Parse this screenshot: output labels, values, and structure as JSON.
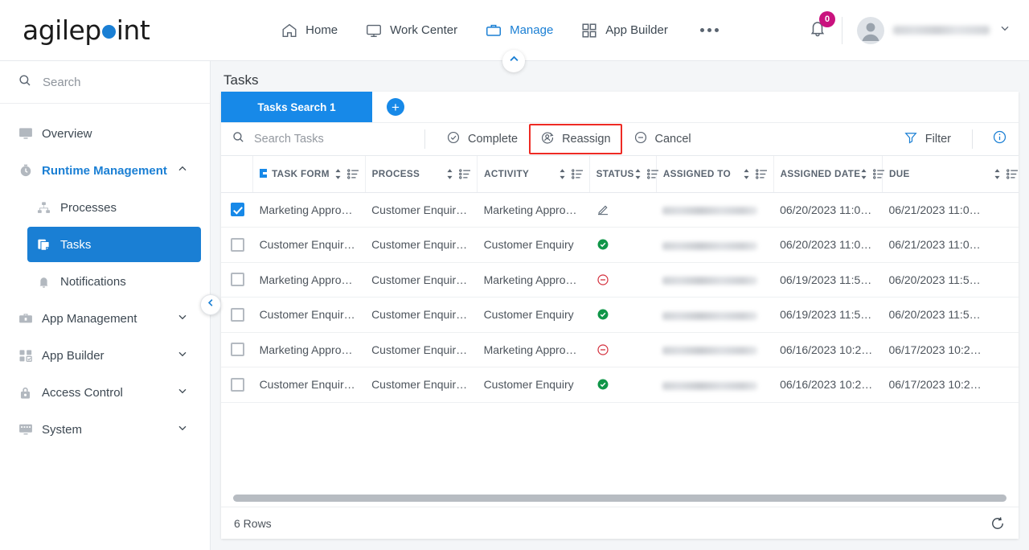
{
  "header": {
    "logo": {
      "prefix": "agilep",
      "suffix": "int",
      "dot_color": "#1a7fd4"
    },
    "nav": [
      {
        "label": "Home",
        "icon": "home-icon",
        "active": false
      },
      {
        "label": "Work Center",
        "icon": "monitor-icon",
        "active": false
      },
      {
        "label": "Manage",
        "icon": "briefcase-icon",
        "active": true
      },
      {
        "label": "App Builder",
        "icon": "grid-icon",
        "active": false
      },
      {
        "label": "",
        "icon": "more-dots-icon",
        "active": false
      }
    ],
    "notification_badge": "0",
    "user_name": "",
    "accent_color": "#1a7fd4",
    "badge_color": "#c9127e"
  },
  "sidebar": {
    "search_placeholder": "Search",
    "items": [
      {
        "label": "Overview",
        "icon": "overview-icon",
        "level": 0,
        "state": "normal",
        "chevron": ""
      },
      {
        "label": "Runtime Management",
        "icon": "clock-icon",
        "level": 0,
        "state": "open",
        "chevron": "up"
      },
      {
        "label": "Processes",
        "icon": "process-icon",
        "level": 1,
        "state": "normal",
        "chevron": ""
      },
      {
        "label": "Tasks",
        "icon": "tasks-icon",
        "level": 1,
        "state": "selected",
        "chevron": ""
      },
      {
        "label": "Notifications",
        "icon": "bell-icon",
        "level": 1,
        "state": "normal",
        "chevron": ""
      },
      {
        "label": "App Management",
        "icon": "toolbox-icon",
        "level": 0,
        "state": "normal",
        "chevron": "down"
      },
      {
        "label": "App Builder",
        "icon": "grid-check-icon",
        "level": 0,
        "state": "normal",
        "chevron": "down"
      },
      {
        "label": "Access Control",
        "icon": "lock-icon",
        "level": 0,
        "state": "normal",
        "chevron": "down"
      },
      {
        "label": "System",
        "icon": "system-icon",
        "level": 0,
        "state": "normal",
        "chevron": "down"
      }
    ]
  },
  "main": {
    "page_title": "Tasks",
    "tab_label": "Tasks Search 1",
    "add_tab_label": "+",
    "search_placeholder": "Search Tasks",
    "toolbar": [
      {
        "label": "Complete",
        "icon": "check-circle-icon",
        "highlighted": false
      },
      {
        "label": "Reassign",
        "icon": "reassign-user-icon",
        "highlighted": true
      },
      {
        "label": "Cancel",
        "icon": "minus-circle-icon",
        "highlighted": false
      }
    ],
    "filter_label": "Filter",
    "info_label": "i",
    "highlight_color": "#ee2b24",
    "columns": [
      "TASK FORM",
      "PROCESS",
      "ACTIVITY",
      "STATUS",
      "ASSIGNED TO",
      "ASSIGNED DATE",
      "DUE"
    ],
    "rows": [
      {
        "checked": true,
        "task_form": "Marketing Appro…",
        "process": "Customer Enquir…",
        "activity": "Marketing Appro…",
        "status": "pencil",
        "assigned_to": "",
        "assigned_date": "06/20/2023 11:0…",
        "due": "06/21/2023 11:0…"
      },
      {
        "checked": false,
        "task_form": "Customer Enquir…",
        "process": "Customer Enquir…",
        "activity": "Customer Enquiry",
        "status": "complete",
        "assigned_to": "",
        "assigned_date": "06/20/2023 11:0…",
        "due": "06/21/2023 11:0…"
      },
      {
        "checked": false,
        "task_form": "Marketing Appro…",
        "process": "Customer Enquir…",
        "activity": "Marketing Appro…",
        "status": "cancelled",
        "assigned_to": "",
        "assigned_date": "06/19/2023 11:5…",
        "due": "06/20/2023 11:5…"
      },
      {
        "checked": false,
        "task_form": "Customer Enquir…",
        "process": "Customer Enquir…",
        "activity": "Customer Enquiry",
        "status": "complete",
        "assigned_to": "",
        "assigned_date": "06/19/2023 11:5…",
        "due": "06/20/2023 11:5…"
      },
      {
        "checked": false,
        "task_form": "Marketing Appro…",
        "process": "Customer Enquir…",
        "activity": "Marketing Appro…",
        "status": "cancelled",
        "assigned_to": "",
        "assigned_date": "06/16/2023 10:2…",
        "due": "06/17/2023 10:2…"
      },
      {
        "checked": false,
        "task_form": "Customer Enquir…",
        "process": "Customer Enquir…",
        "activity": "Customer Enquiry",
        "status": "complete",
        "assigned_to": "",
        "assigned_date": "06/16/2023 10:2…",
        "due": "06/17/2023 10:2…"
      }
    ],
    "footer_rows": "6 Rows"
  }
}
